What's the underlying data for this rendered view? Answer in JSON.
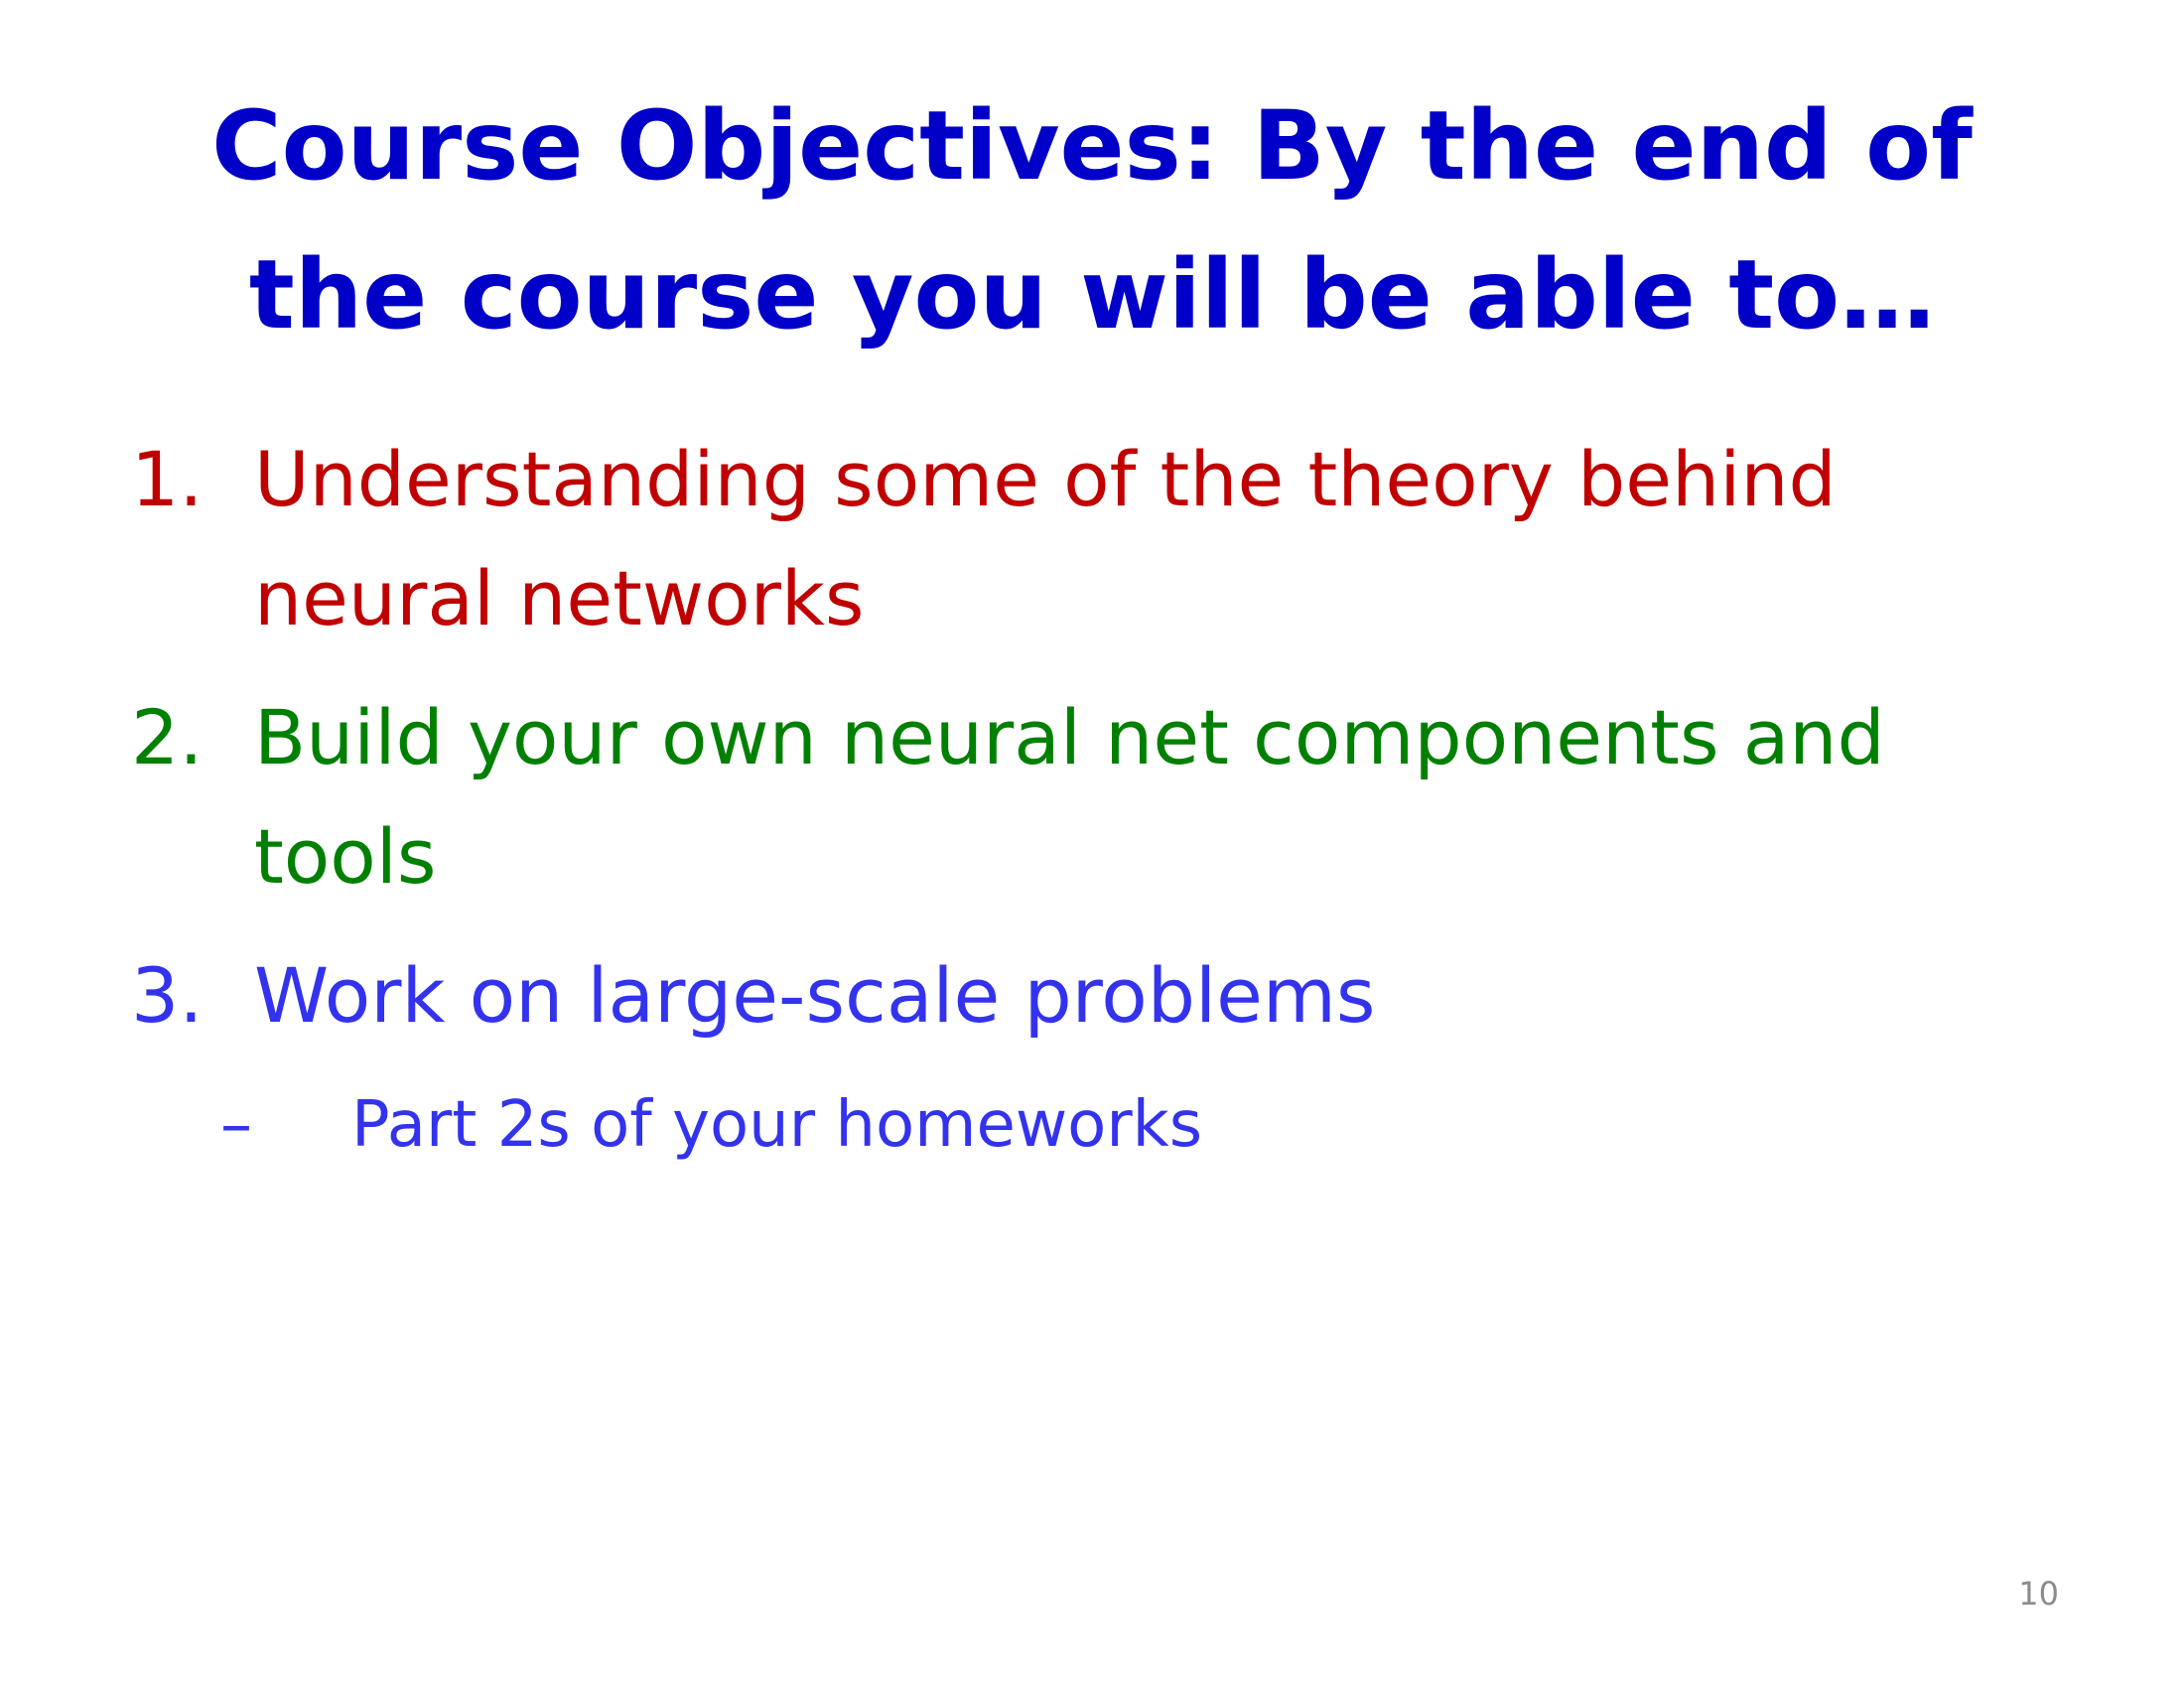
{
  "slide": {
    "title": "Course Objectives: By the end of the course you will be able to…",
    "objectives": [
      {
        "number": "1.",
        "text": "Understanding some of the theory behind neural networks",
        "color": "#c00000"
      },
      {
        "number": "2.",
        "text": "Build your own neural net components and tools",
        "color": "#008000"
      },
      {
        "number": "3.",
        "text": "Work on large-scale problems",
        "color": "#3333ee"
      }
    ],
    "sub_items": [
      {
        "bullet": "–",
        "text": "Part 2s of your homeworks"
      }
    ],
    "page_number": "10",
    "colors": {
      "title": "#0000c8",
      "page_number": "#8c8c8c"
    }
  }
}
